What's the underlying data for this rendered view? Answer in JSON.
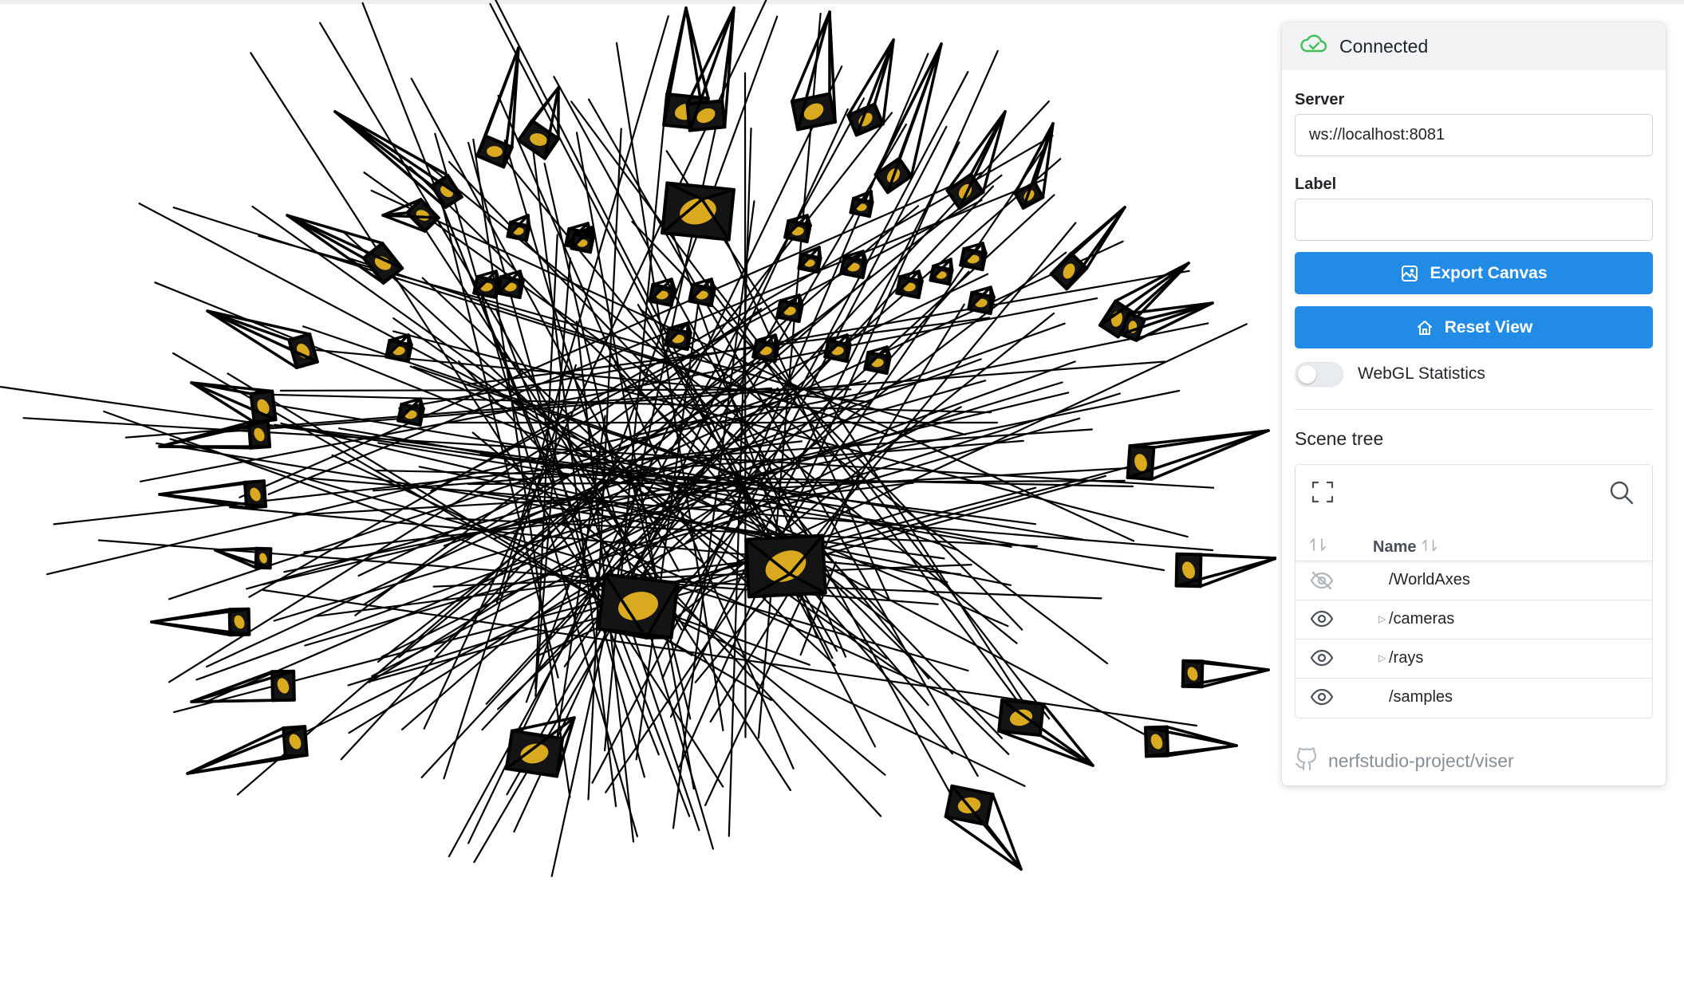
{
  "status": {
    "text": "Connected",
    "icon": "cloud-check-icon",
    "color": "#40c057"
  },
  "server": {
    "label": "Server",
    "value": "ws://localhost:8081"
  },
  "label_field": {
    "label": "Label",
    "value": ""
  },
  "buttons": {
    "export_label": "Export Canvas",
    "export_icon": "photo-icon",
    "reset_label": "Reset View",
    "reset_icon": "home-icon",
    "color": "#228be6"
  },
  "webgl": {
    "label": "WebGL Statistics",
    "enabled": false
  },
  "scene_tree": {
    "title": "Scene tree",
    "column_header": "Name",
    "rows": [
      {
        "name": "/WorldAxes",
        "visible": false,
        "expandable": false
      },
      {
        "name": "/cameras",
        "visible": true,
        "expandable": true
      },
      {
        "name": "/rays",
        "visible": true,
        "expandable": true
      },
      {
        "name": "/samples",
        "visible": true,
        "expandable": false
      }
    ]
  },
  "footer": {
    "repo": "nerfstudio-project/viser",
    "icon": "github-icon"
  }
}
